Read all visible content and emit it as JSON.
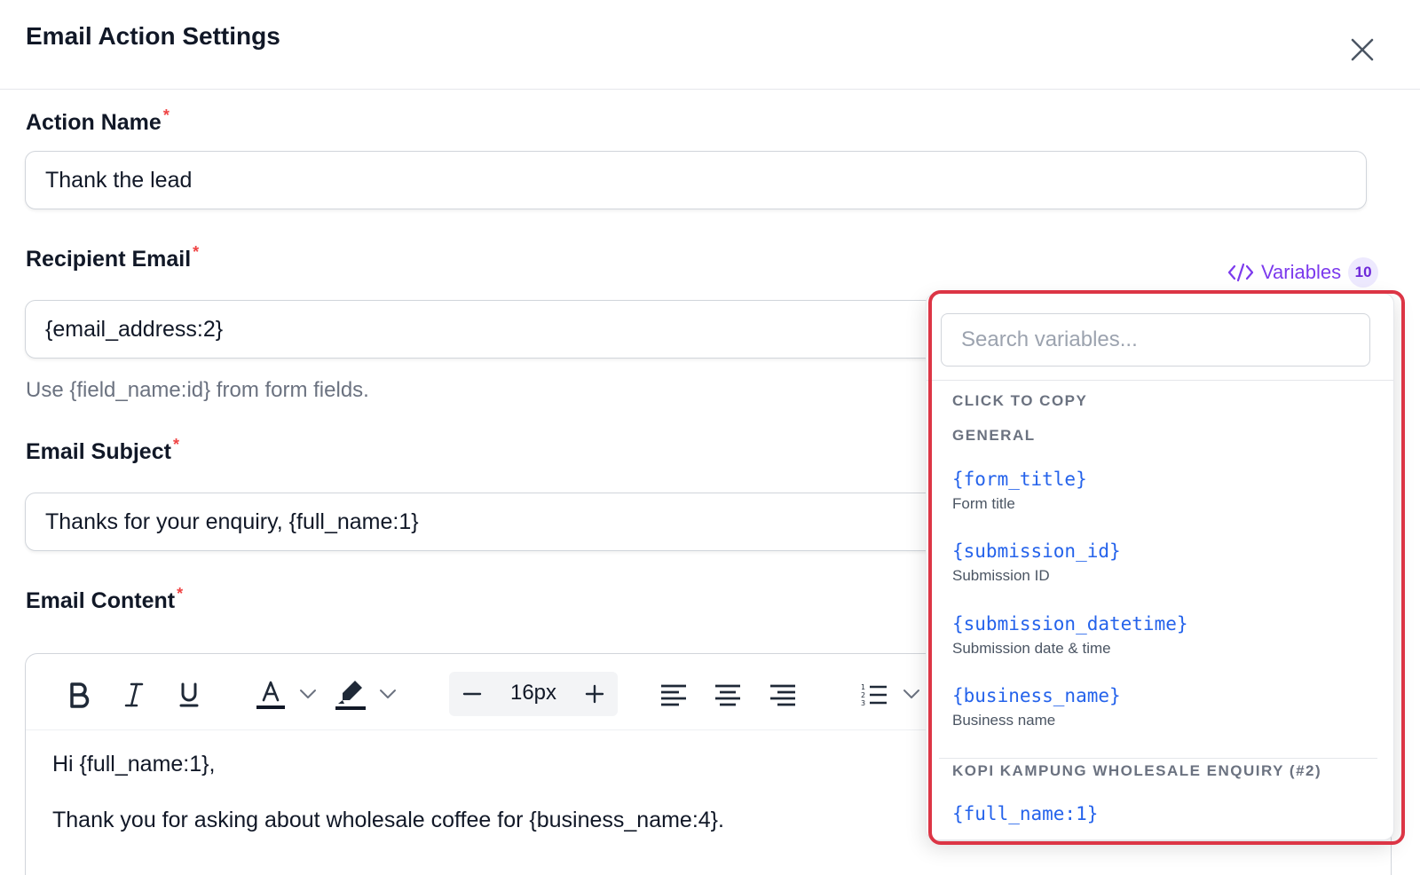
{
  "header": {
    "title": "Email Action Settings"
  },
  "action_name": {
    "label": "Action Name",
    "required_mark": "*",
    "value": "Thank the lead"
  },
  "recipient_email": {
    "label": "Recipient Email",
    "required_mark": "*",
    "value": "{email_address:2}",
    "help": "Use {field_name:id} from form fields."
  },
  "variables_button": {
    "icon": "code-icon",
    "label": "Variables",
    "count": "10"
  },
  "email_subject": {
    "label": "Email Subject",
    "required_mark": "*",
    "value": "Thanks for your enquiry, {full_name:1}"
  },
  "email_content": {
    "label": "Email Content",
    "required_mark": "*",
    "toolbar": {
      "font_size": "16px"
    },
    "body": [
      "Hi {full_name:1},",
      "Thank you for asking about wholesale coffee for {business_name:4}."
    ]
  },
  "variables_popover": {
    "search_placeholder": "Search variables...",
    "hint": "CLICK TO COPY",
    "groups": [
      {
        "title": "GENERAL",
        "items": [
          {
            "code": "{form_title}",
            "desc": "Form title"
          },
          {
            "code": "{submission_id}",
            "desc": "Submission ID"
          },
          {
            "code": "{submission_datetime}",
            "desc": "Submission date & time"
          },
          {
            "code": "{business_name}",
            "desc": "Business name"
          }
        ]
      },
      {
        "title": "KOPI KAMPUNG WHOLESALE ENQUIRY (#2)",
        "items": [
          {
            "code": "{full_name:1}",
            "desc": ""
          }
        ]
      }
    ]
  },
  "colors": {
    "accent": "#7c3aed",
    "variable_code": "#2563eb",
    "required": "#ef4444",
    "highlight": "#dc3545"
  }
}
